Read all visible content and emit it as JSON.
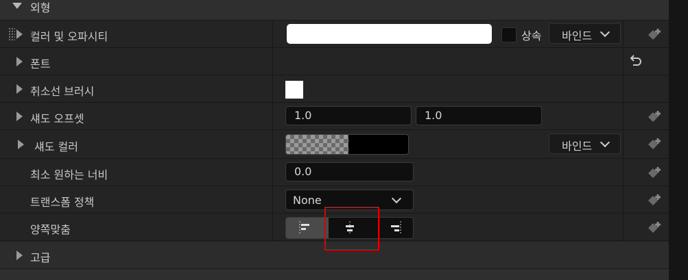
{
  "section_appearance": {
    "label": "외형",
    "icon": "collapse-triangle-icon"
  },
  "rows": {
    "color_opacity": {
      "label": "컬러 및 오파시티",
      "inherit_label": "상속",
      "bind_label": "바인드",
      "color": "#ffffff"
    },
    "font": {
      "label": "폰트"
    },
    "strike_brush": {
      "label": "취소선 브러시",
      "color": "#ffffff"
    },
    "shadow_offset": {
      "label": "섀도 오프셋",
      "x": "1.0",
      "y": "1.0"
    },
    "shadow_color": {
      "label": "섀도 컬러",
      "bind_label": "바인드",
      "color": "#000000"
    },
    "min_width": {
      "label": "최소 원하는 너비",
      "value": "0.0"
    },
    "transform_policy": {
      "label": "트랜스폼 정책",
      "value": "None"
    },
    "justification": {
      "label": "양쪽맞춤",
      "options": [
        "left",
        "center",
        "right"
      ],
      "selected": "left"
    }
  },
  "section_advanced": {
    "label": "고급"
  },
  "colors": {
    "highlight": "#e00000",
    "panel": "#242424",
    "field": "#0f0f0f"
  }
}
